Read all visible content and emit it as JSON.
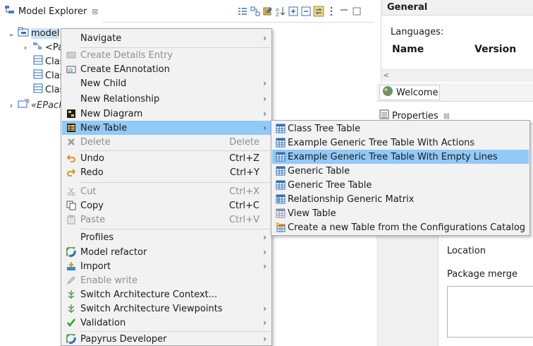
{
  "explorer": {
    "title": "Model Explorer",
    "close_glyph": "⊠",
    "toolbar_icons": [
      "collapse-list-icon",
      "link-editor-icon",
      "filter-icon",
      "sort-icon",
      "expand-all-icon",
      "collapse-all-icon",
      "sync-icon",
      "view-menu-icon",
      "minimize-icon",
      "maximize-icon"
    ],
    "tree": [
      {
        "label": "model",
        "twisty": "❯",
        "icon": "model-icon"
      },
      {
        "label": "<Pa",
        "twisty": "›",
        "icon": "package-import-icon"
      },
      {
        "label": "Clas",
        "icon": "class-icon"
      },
      {
        "label": "Clas",
        "icon": "class-icon"
      },
      {
        "label": "Clas",
        "icon": "class-icon"
      },
      {
        "label": "«EPack",
        "twisty": "›",
        "icon": "epackage-icon"
      }
    ]
  },
  "general": {
    "header": "General",
    "languages_label": "Languages:",
    "columns": [
      "Name",
      "Version"
    ],
    "scroll_left": "<"
  },
  "welcome_tab": {
    "label": "Welcome"
  },
  "properties_tab": {
    "label": "Properties",
    "close_glyph": "⊠"
  },
  "properties": {
    "location_label": "Location",
    "package_merge_label": "Package merge"
  },
  "context_menu": {
    "items": [
      {
        "label": "Navigate",
        "submenu": true,
        "enabled": true
      },
      {
        "label": "Create Details Entry",
        "enabled": false,
        "icon": "details-entry-icon"
      },
      {
        "label": "Create EAnnotation",
        "enabled": true,
        "icon": "eannotation-icon"
      },
      {
        "label": "New Child",
        "submenu": true,
        "enabled": true
      },
      {
        "label": "New Relationship",
        "submenu": true,
        "enabled": true
      },
      {
        "label": "New Diagram",
        "submenu": true,
        "enabled": true,
        "icon": "diagram-icon"
      },
      {
        "label": "New Table",
        "submenu": true,
        "enabled": true,
        "highlighted": true,
        "icon": "table-icon"
      },
      {
        "label": "Delete",
        "accel": "Delete",
        "enabled": false,
        "icon": "delete-icon"
      },
      {
        "label": "Undo",
        "accel": "Ctrl+Z",
        "enabled": true,
        "icon": "undo-icon"
      },
      {
        "label": "Redo",
        "accel": "Ctrl+Y",
        "enabled": true,
        "icon": "redo-icon"
      },
      {
        "label": "Cut",
        "accel": "Ctrl+X",
        "enabled": false,
        "icon": "cut-icon"
      },
      {
        "label": "Copy",
        "accel": "Ctrl+C",
        "enabled": true,
        "icon": "copy-icon"
      },
      {
        "label": "Paste",
        "accel": "Ctrl+V",
        "enabled": false,
        "icon": "paste-icon"
      },
      {
        "label": "Profiles",
        "submenu": true,
        "enabled": true
      },
      {
        "label": "Model refactor",
        "submenu": true,
        "enabled": true,
        "icon": "refactor-icon"
      },
      {
        "label": "Import",
        "submenu": true,
        "enabled": true,
        "icon": "import-icon"
      },
      {
        "label": "Enable write",
        "enabled": false,
        "icon": "pencil-icon"
      },
      {
        "label": "Switch Architecture Context...",
        "enabled": true,
        "icon": "architecture-icon"
      },
      {
        "label": "Switch Architecture Viewpoints",
        "submenu": true,
        "enabled": true,
        "icon": "architecture-icon"
      },
      {
        "label": "Validation",
        "submenu": true,
        "enabled": true,
        "icon": "check-icon"
      },
      {
        "label": "Papyrus Developer",
        "submenu": true,
        "enabled": true,
        "icon": "papyrus-icon"
      }
    ],
    "arrow_glyph": "›"
  },
  "sub_menu": {
    "items": [
      {
        "label": "Class Tree Table",
        "icon": "table-icon"
      },
      {
        "label": "Example Generic Tree Table With Actions",
        "icon": "table-icon"
      },
      {
        "label": "Example Generic Tree Table With Empty Lines",
        "icon": "table-icon",
        "highlighted": true
      },
      {
        "label": "Generic Table",
        "icon": "table-icon"
      },
      {
        "label": "Generic Tree Table",
        "icon": "table-icon"
      },
      {
        "label": "Relationship Generic Matrix",
        "icon": "matrix-icon"
      },
      {
        "label": "View Table",
        "icon": "view-table-icon"
      },
      {
        "label": "Create a new Table from the Configurations Catalog",
        "icon": "catalog-table-icon"
      }
    ]
  },
  "colors": {
    "highlight": "#91c9f7",
    "menu_bg": "#f2f2f2",
    "disabled_text": "#8e8e8e",
    "accent_blue": "#2f6fb5"
  }
}
